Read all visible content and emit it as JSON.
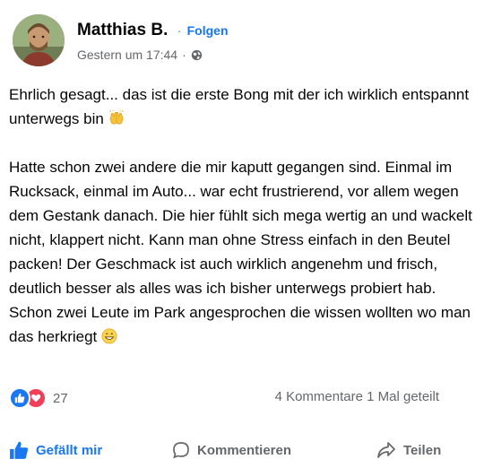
{
  "post": {
    "author": "Matthias B.",
    "follow_label": "Folgen",
    "separator": "·",
    "timestamp": "Gestern um 17:44",
    "audience_icon": "globe-icon",
    "paragraphs": [
      "Ehrlich gesagt...  das ist die erste Bong mit der ich wirklich entspannt unterwegs bin",
      "Hatte schon zwei andere die mir kaputt gegangen sind. Einmal im Rucksack, einmal im Auto... war echt frustrierend, vor allem wegen dem Gestank danach. Die hier fühlt sich mega wertig an und wackelt nicht, klappert nicht. Kann man ohne Stress einfach in den Beutel packen! Der Geschmack ist auch wirklich angenehm und frisch, deutlich besser als alles was ich bisher unterwegs probiert hab. Schon zwei Leute im Park angesprochen die wissen wollten wo man das herkriegt"
    ],
    "emoji_1": "raising-hands-emoji",
    "emoji_2": "grinning-face-emoji"
  },
  "stats": {
    "reaction_count": "27",
    "comments": "4 Kommentare",
    "shares": "1 Mal geteilt",
    "reaction_icons": [
      "like-icon",
      "love-icon"
    ]
  },
  "actions": {
    "like_label": "Gefällt mir",
    "comment_label": "Kommentieren",
    "share_label": "Teilen"
  },
  "colors": {
    "accent": "#1877f2",
    "love": "#f33e58",
    "secondary_text": "#65676b",
    "primary_text": "#050505"
  }
}
